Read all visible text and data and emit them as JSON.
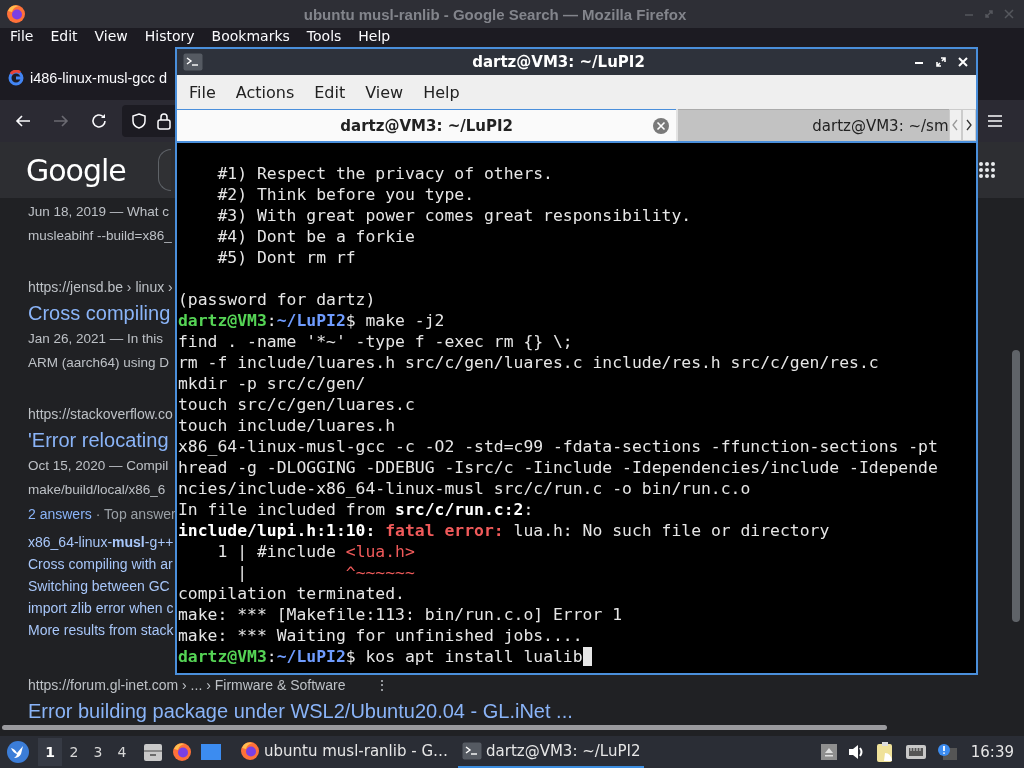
{
  "browser": {
    "title": "ubuntu musl-ranlib - Google Search — Mozilla Firefox",
    "menu": [
      "File",
      "Edit",
      "View",
      "History",
      "Bookmarks",
      "Tools",
      "Help"
    ],
    "tab": {
      "title": "i486-linux-musl-gcc d"
    },
    "logo": "Google",
    "results": [
      {
        "kind": "snippet",
        "text": "Jun 18, 2019 — What c"
      },
      {
        "kind": "snippet",
        "text": "musleabihf --build=x86_"
      },
      {
        "kind": "url",
        "text": "https://jensd.be › linux ›"
      },
      {
        "kind": "title",
        "text": "Cross compiling"
      },
      {
        "kind": "snippet",
        "text": "Jan 26, 2021 — In this"
      },
      {
        "kind": "snippet",
        "text": "ARM (aarch64) using D"
      },
      {
        "kind": "url",
        "text": "https://stackoverflow.co"
      },
      {
        "kind": "title",
        "text": "'Error relocating"
      },
      {
        "kind": "snippet",
        "text": "Oct 15, 2020 — Compil"
      },
      {
        "kind": "snippet",
        "text": "make/build/local/x86_6"
      },
      {
        "kind": "meta",
        "link": "2 answers",
        "text": "· Top answer"
      },
      {
        "kind": "sublink",
        "text": "x86_64-linux-**musl**-g++"
      },
      {
        "kind": "sublink",
        "text": "Cross compiling with ar"
      },
      {
        "kind": "sublink",
        "text": "Switching between GC"
      },
      {
        "kind": "sublink",
        "text": "import zlib error when c"
      },
      {
        "kind": "sublink",
        "text": "More results from stack"
      },
      {
        "kind": "url",
        "text": "https://forum.gl-inet.com › ... › Firmware & Software",
        "more": "⋮"
      },
      {
        "kind": "title",
        "text": "Error building package under WSL2/Ubuntu20.04 - GL.iNet ..."
      }
    ]
  },
  "terminal": {
    "title": "dartz@VM3: ~/LuPI2",
    "menu": [
      "File",
      "Actions",
      "Edit",
      "View",
      "Help"
    ],
    "tabs": [
      {
        "label": "dartz@VM3: ~/LuPI2",
        "selected": true
      },
      {
        "label": "dartz@VM3: ~/sm",
        "selected": false
      }
    ],
    "lines": [
      {
        "kind": "output",
        "segments": [
          {
            "text": "    #1) Respect the privacy of others.",
            "kind": "plain"
          }
        ]
      },
      {
        "kind": "output",
        "segments": [
          {
            "text": "    #2) Think before you type.",
            "kind": "plain"
          }
        ]
      },
      {
        "kind": "output",
        "segments": [
          {
            "text": "    #3) With great power comes great responsibility.",
            "kind": "plain"
          }
        ]
      },
      {
        "kind": "output",
        "segments": [
          {
            "text": "    #4) Dont be a forkie",
            "kind": "plain"
          }
        ]
      },
      {
        "kind": "output",
        "segments": [
          {
            "text": "    #5) Dont rm rf",
            "kind": "plain"
          }
        ]
      },
      {
        "kind": "blank"
      },
      {
        "kind": "output",
        "segments": [
          {
            "text": "(password for dartz)",
            "kind": "plain"
          }
        ]
      },
      {
        "kind": "output",
        "segments": [
          {
            "text": "dartz@VM3",
            "kind": "user"
          },
          {
            "text": ":",
            "kind": "plain"
          },
          {
            "text": "~/LuPI2",
            "kind": "path"
          },
          {
            "text": "$ make -j2",
            "kind": "plain"
          }
        ]
      },
      {
        "kind": "output",
        "segments": [
          {
            "text": "find . -name '*~' -type f -exec rm {} \\;",
            "kind": "plain"
          }
        ]
      },
      {
        "kind": "output",
        "segments": [
          {
            "text": "rm -f include/luares.h src/c/gen/luares.c include/res.h src/c/gen/res.c",
            "kind": "plain"
          }
        ]
      },
      {
        "kind": "output",
        "segments": [
          {
            "text": "mkdir -p src/c/gen/",
            "kind": "plain"
          }
        ]
      },
      {
        "kind": "output",
        "segments": [
          {
            "text": "touch src/c/gen/luares.c",
            "kind": "plain"
          }
        ]
      },
      {
        "kind": "output",
        "segments": [
          {
            "text": "touch include/luares.h",
            "kind": "plain"
          }
        ]
      },
      {
        "kind": "output",
        "segments": [
          {
            "text": "x86_64-linux-musl-gcc -c -O2 -std=c99 -fdata-sections -ffunction-sections -pt",
            "kind": "plain"
          }
        ]
      },
      {
        "kind": "output",
        "segments": [
          {
            "text": "hread -g -DLOGGING -DDEBUG -Isrc/c -Iinclude -Idependencies/include -Idepende",
            "kind": "plain"
          }
        ]
      },
      {
        "kind": "output",
        "segments": [
          {
            "text": "ncies/include-x86_64-linux-musl src/c/run.c -o bin/run.c.o",
            "kind": "plain"
          }
        ]
      },
      {
        "kind": "output",
        "segments": [
          {
            "text": "In file included from ",
            "kind": "plain"
          },
          {
            "text": "src/c/run.c:2",
            "kind": "bold"
          },
          {
            "text": ":",
            "kind": "plain"
          }
        ]
      },
      {
        "kind": "output",
        "segments": [
          {
            "text": "include/lupi.h:1:10: ",
            "kind": "bold"
          },
          {
            "text": "fatal error:",
            "kind": "error"
          },
          {
            "text": " lua.h: No such file or directory",
            "kind": "plain"
          }
        ]
      },
      {
        "kind": "output",
        "segments": [
          {
            "text": "    1 | #include ",
            "kind": "plain"
          },
          {
            "text": "<lua.h>",
            "kind": "red"
          }
        ]
      },
      {
        "kind": "output",
        "segments": [
          {
            "text": "      |          ",
            "kind": "plain"
          },
          {
            "text": "^~~~~~~",
            "kind": "red"
          }
        ]
      },
      {
        "kind": "output",
        "segments": [
          {
            "text": "compilation terminated.",
            "kind": "plain"
          }
        ]
      },
      {
        "kind": "output",
        "segments": [
          {
            "text": "make: *** [Makefile:113: bin/run.c.o] Error 1",
            "kind": "plain"
          }
        ]
      },
      {
        "kind": "output",
        "segments": [
          {
            "text": "make: *** Waiting for unfinished jobs....",
            "kind": "plain"
          }
        ]
      },
      {
        "kind": "input",
        "segments": [
          {
            "text": "dartz@VM3",
            "kind": "user"
          },
          {
            "text": ":",
            "kind": "plain"
          },
          {
            "text": "~/LuPI2",
            "kind": "path"
          },
          {
            "text": "$ kos apt install lualib",
            "kind": "plain"
          }
        ]
      }
    ]
  },
  "taskbar": {
    "workspaces": [
      {
        "label": "1",
        "selected": true
      },
      {
        "label": "2",
        "selected": false
      },
      {
        "label": "3",
        "selected": false
      },
      {
        "label": "4",
        "selected": false
      }
    ],
    "tasks": [
      {
        "kind": "browser",
        "label": "ubuntu musl-ranlib - G…",
        "selected": false
      },
      {
        "kind": "terminal",
        "label": "dartz@VM3: ~/LuPI2",
        "selected": true
      }
    ],
    "clock": "16:39"
  }
}
